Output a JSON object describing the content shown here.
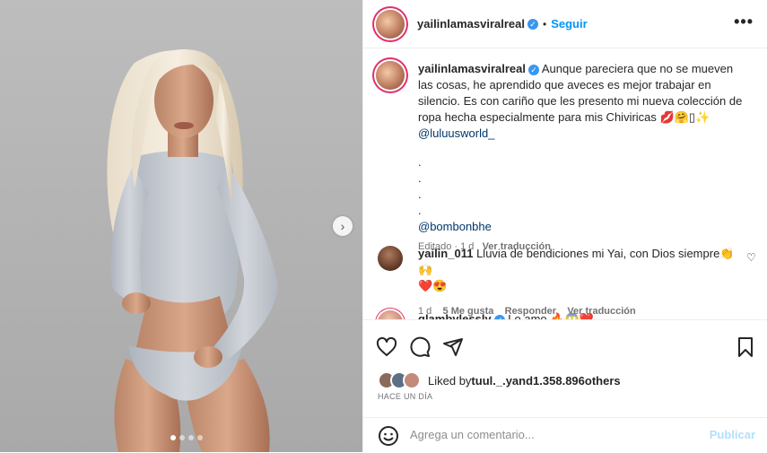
{
  "post": {
    "username": "yailinlamasviralreal",
    "separator": "•",
    "follow_label": "Seguir",
    "more_label": "•••",
    "image_alt_dots": 4,
    "next_label": "›"
  },
  "caption": {
    "username": "yailinlamasviralreal",
    "text": "Aunque pareciera que no se mueven las cosas, he aprendido que aveces es mejor trabajar en silencio. Es con cariño que les presento mi nueva colección de ropa hecha especialmente para mis Chiviricas",
    "emojis": "💋🤗▯✨",
    "mention1": "@luluusworld_",
    "dot1": ".",
    "dot2": ".",
    "dot3": ".",
    "dot4": ".",
    "mention2": "@bombonbhe",
    "edited": "Editado",
    "dot_sep": "·",
    "time": "1 d",
    "translate": "Ver traducción"
  },
  "comments": [
    {
      "username": "yailin_011",
      "text": "Lluvia de bendiciones mi Yai, con Dios siempre👏🙌",
      "emojis_line2": "❤️😍",
      "time": "1 d",
      "likes": "5 Me gusta",
      "reply": "Responder",
      "translate": "Ver traducción"
    },
    {
      "username": "glambylessly",
      "text": "Lo amo 🔥😱❤️"
    }
  ],
  "likes": {
    "prefix": "Liked by",
    "user": "tuul._.yand",
    "count": "1.358.896",
    "suffix": "others"
  },
  "time_ago": "HACE UN DÍA",
  "comment_box": {
    "placeholder": "Agrega un comentario...",
    "publish": "Publicar"
  },
  "colors": {
    "accent": "#0095f6",
    "verified": "#3897f0",
    "mention": "#00376b",
    "muted": "#737373"
  }
}
